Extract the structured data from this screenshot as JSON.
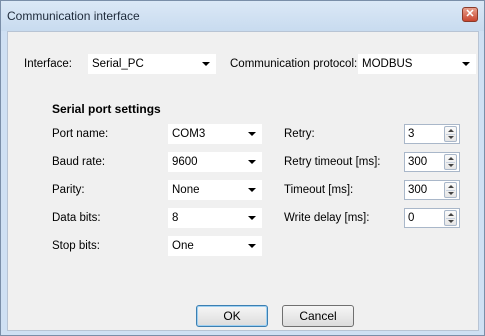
{
  "window": {
    "title": "Communication interface",
    "close_glyph": "✕"
  },
  "interface": {
    "label": "Interface:",
    "value": "Serial_PC"
  },
  "protocol": {
    "label": "Communication protocol:",
    "value": "MODBUS"
  },
  "serial": {
    "section_title": "Serial port settings",
    "port_name": {
      "label": "Port name:",
      "value": "COM3"
    },
    "baud_rate": {
      "label": "Baud rate:",
      "value": "9600"
    },
    "parity": {
      "label": "Parity:",
      "value": "None"
    },
    "data_bits": {
      "label": "Data bits:",
      "value": "8"
    },
    "stop_bits": {
      "label": "Stop bits:",
      "value": "One"
    },
    "retry": {
      "label": "Retry:",
      "value": "3"
    },
    "retry_timeout": {
      "label": "Retry timeout [ms]:",
      "value": "300"
    },
    "timeout": {
      "label": "Timeout [ms]:",
      "value": "300"
    },
    "write_delay": {
      "label": "Write delay [ms]:",
      "value": "0"
    }
  },
  "buttons": {
    "ok": "OK",
    "cancel": "Cancel"
  },
  "colors": {
    "title_bar": "#cfe0f3",
    "client_bg": "#f0f0f0",
    "close_button": "#c8452f",
    "default_button_border": "#3c7fb1"
  }
}
